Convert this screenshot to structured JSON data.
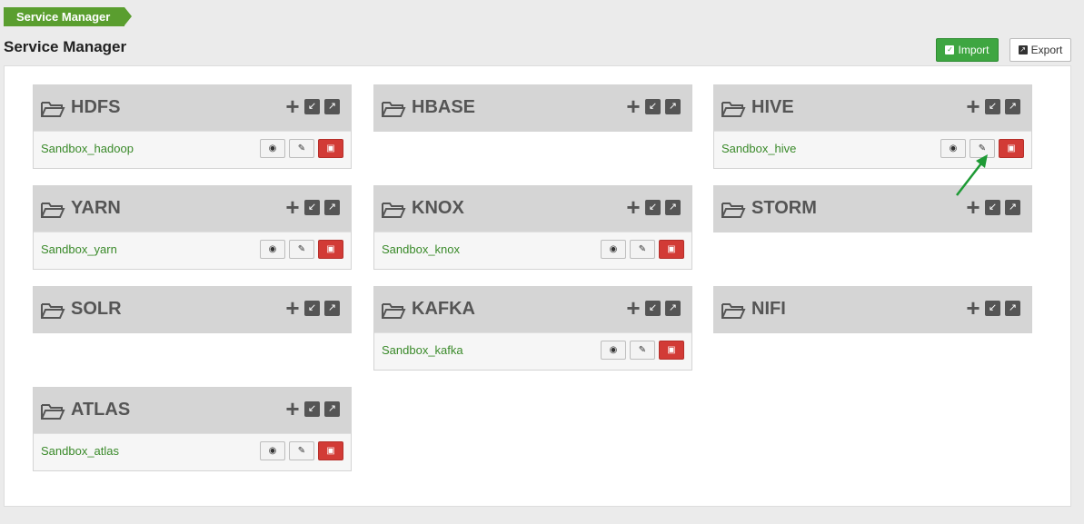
{
  "breadcrumb": "Service Manager",
  "page_title": "Service Manager",
  "toolbar": {
    "import_label": "Import",
    "export_label": "Export"
  },
  "colors": {
    "accent_green": "#3ea641",
    "delete_red": "#d23b36",
    "link_green": "#3a8a2a"
  },
  "services": [
    {
      "name": "HDFS",
      "repos": [
        "Sandbox_hadoop"
      ]
    },
    {
      "name": "HBASE",
      "repos": []
    },
    {
      "name": "HIVE",
      "repos": [
        "Sandbox_hive"
      ]
    },
    {
      "name": "YARN",
      "repos": [
        "Sandbox_yarn"
      ]
    },
    {
      "name": "KNOX",
      "repos": [
        "Sandbox_knox"
      ]
    },
    {
      "name": "STORM",
      "repos": []
    },
    {
      "name": "SOLR",
      "repos": []
    },
    {
      "name": "KAFKA",
      "repos": [
        "Sandbox_kafka"
      ]
    },
    {
      "name": "NIFI",
      "repos": []
    },
    {
      "name": "ATLAS",
      "repos": [
        "Sandbox_atlas"
      ]
    }
  ]
}
